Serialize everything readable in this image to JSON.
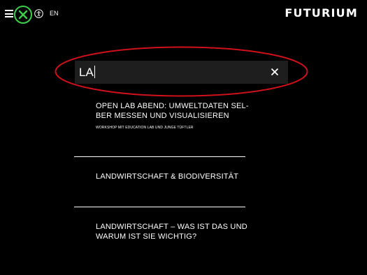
{
  "header": {
    "menu_icon": "hamburger-icon",
    "search_toggle_icon": "close-icon",
    "search_toggle_color": "#3cd04a",
    "accessibility_icon": "accessibility-icon",
    "language": "EN",
    "logo": "FUTURIUM"
  },
  "search": {
    "value": "LA",
    "clear_icon": "close-icon",
    "background": "#1e1e1e"
  },
  "annotation": {
    "highlight_color": "#d0111b"
  },
  "results": [
    {
      "title": "OPEN LAB ABEND: UMWELTDATEN SEL-\nBER MESSEN UND VISUALISIEREN",
      "subtitle": "WORKSHOP MIT EDUCATION LAB UND JUNGE TÜFTLER"
    },
    {
      "title": "LANDWIRTSCHAFT & BIODIVERSITÄT"
    },
    {
      "title": "LANDWIRTSCHAFT – WAS IST DAS UND\nWARUM IST SIE WICHTIG?"
    }
  ]
}
